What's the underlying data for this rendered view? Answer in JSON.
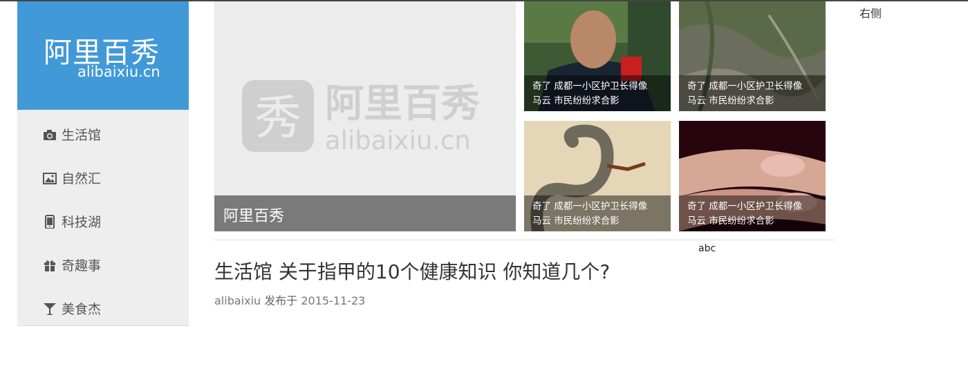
{
  "logo": {
    "cn": "阿里百秀",
    "en": "alibaixiu.cn"
  },
  "sidebar": {
    "items": [
      {
        "label": "生活馆",
        "icon": "camera-icon"
      },
      {
        "label": "自然汇",
        "icon": "picture-icon"
      },
      {
        "label": "科技湖",
        "icon": "phone-icon"
      },
      {
        "label": "奇趣事",
        "icon": "gift-icon"
      },
      {
        "label": "美食杰",
        "icon": "glass-icon"
      }
    ]
  },
  "hero": {
    "caption": "阿里百秀",
    "watermark_cn": "阿里百秀",
    "watermark_en": "alibaixiu.cn",
    "watermark_glyph": "秀"
  },
  "thumbs": [
    {
      "line1": "奇了 成都一小区护卫长得像",
      "line2": "马云 市民纷纷求合影"
    },
    {
      "line1": "奇了 成都一小区护卫长得像",
      "line2": "马云 市民纷纷求合影"
    },
    {
      "line1": "奇了 成都一小区护卫长得像",
      "line2": "马云 市民纷纷求合影"
    },
    {
      "line1": "奇了 成都一小区护卫长得像",
      "line2": "马云 市民纷纷求合影"
    }
  ],
  "right_label": "右侧",
  "abc_label": "abc",
  "article": {
    "title": "生活馆 关于指甲的10个健康知识 你知道几个?",
    "author": "alibaixiu",
    "published_prefix": "发布于",
    "date": "2015-11-23"
  },
  "colors": {
    "brand_blue": "#4199d8",
    "sidebar_bg": "#eeeeee",
    "caption_bg": "#7a7a7a"
  }
}
